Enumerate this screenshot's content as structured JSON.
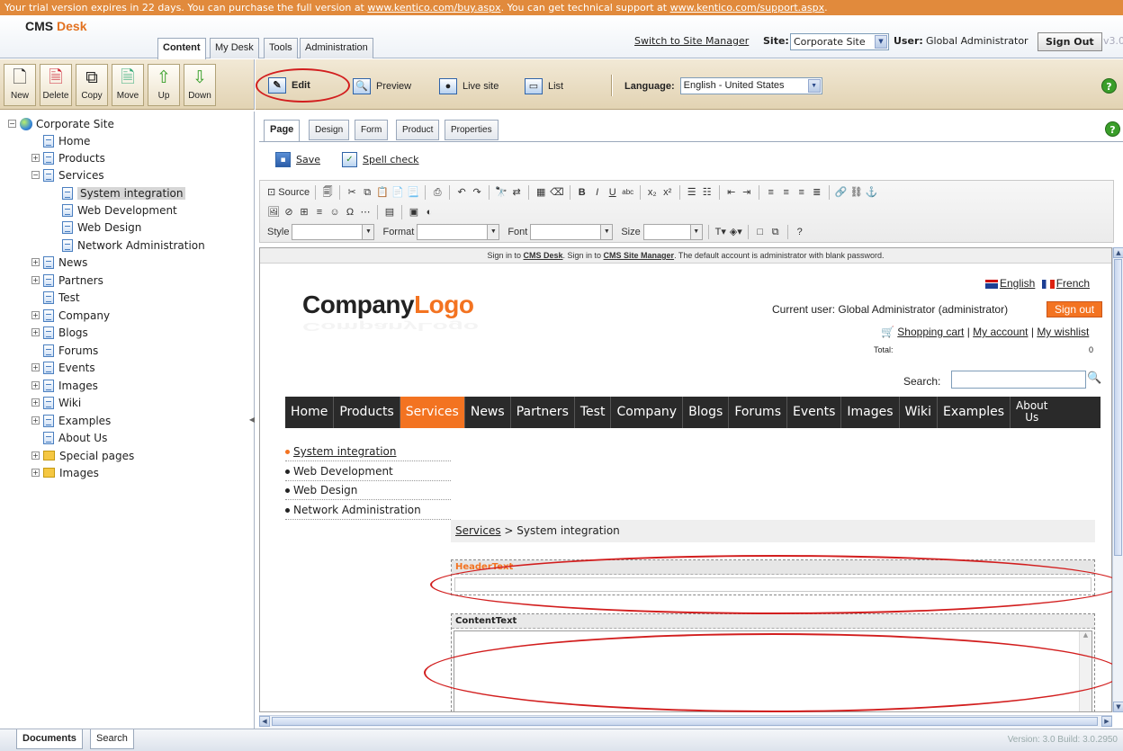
{
  "trial": {
    "text1": "Your trial version expires in 22 days. You can purchase the full version at ",
    "link1": "www.kentico.com/buy.aspx",
    "text2": ". You can get technical support at ",
    "link2": "www.kentico.com/support.aspx",
    "text3": "."
  },
  "brand": {
    "part1": "CMS",
    "part2": "Desk"
  },
  "main_tabs": [
    "Content",
    "My Desk",
    "Tools",
    "Administration"
  ],
  "header": {
    "switch_link": "Switch to Site Manager",
    "site_label": "Site:",
    "site_value": "Corporate Site",
    "user_label": "User:",
    "user_value": "Global Administrator",
    "sign_out": "Sign Out",
    "version_short": "v3.0"
  },
  "left_toolbar": [
    {
      "label": "New",
      "icon": "new-document-icon"
    },
    {
      "label": "Delete",
      "icon": "delete-document-icon"
    },
    {
      "label": "Copy",
      "icon": "copy-document-icon"
    },
    {
      "label": "Move",
      "icon": "move-document-icon"
    },
    {
      "label": "Up",
      "icon": "arrow-up-icon"
    },
    {
      "label": "Down",
      "icon": "arrow-down-icon"
    }
  ],
  "view_modes": {
    "edit": "Edit",
    "preview": "Preview",
    "live": "Live site",
    "list": "List"
  },
  "language": {
    "label": "Language:",
    "value": "English - United States"
  },
  "tree": {
    "root": "Corporate Site",
    "nodes": [
      "Home",
      "Products",
      "Services",
      "System integration",
      "Web Development",
      "Web Design",
      "Network Administration",
      "News",
      "Partners",
      "Test",
      "Company",
      "Blogs",
      "Forums",
      "Events",
      "Images",
      "Wiki",
      "Examples",
      "About Us",
      "Special pages",
      "Images"
    ]
  },
  "page_tabs": [
    "Page",
    "Design",
    "Form",
    "Product",
    "Properties"
  ],
  "edit_actions": {
    "save": "Save",
    "spell": "Spell check"
  },
  "editor": {
    "source": "Source",
    "style": "Style",
    "format": "Format",
    "font": "Font",
    "size": "Size"
  },
  "preview": {
    "info_pre": "Sign in to ",
    "info_link1": "CMS Desk",
    "info_mid": ". Sign in to ",
    "info_link2": "CMS Site Manager",
    "info_post": ". The default account is administrator with blank password.",
    "logo_company": "Company",
    "logo_logo": "Logo",
    "lang_en": "English",
    "lang_fr": "French",
    "current_user": "Current user:  Global Administrator (administrator)",
    "sign_out": "Sign out",
    "cart": "Shopping cart",
    "account": "My account",
    "wishlist": "My wishlist",
    "divider": " | ",
    "total_label": "Total:",
    "total_value": "0",
    "search_label": "Search:",
    "menu": [
      "Home",
      "Products",
      "Services",
      "News",
      "Partners",
      "Test",
      "Company",
      "Blogs",
      "Forums",
      "Events",
      "Images",
      "Wiki",
      "Examples"
    ],
    "menu_last_1": "About",
    "menu_last_2": "Us",
    "submenu": [
      "System integration",
      "Web Development",
      "Web Design",
      "Network Administration"
    ],
    "crumb_link": "Services",
    "crumb_rest": " > System integration",
    "header_text_title": "HeaderText",
    "content_text_title": "ContentText"
  },
  "bottom_tabs": [
    "Documents",
    "Search"
  ],
  "version": "Version: 3.0 Build: 3.0.2950",
  "colors": {
    "accent": "#f37321",
    "trial_bar": "#e18a3c",
    "highlight": "#d21e1e"
  }
}
